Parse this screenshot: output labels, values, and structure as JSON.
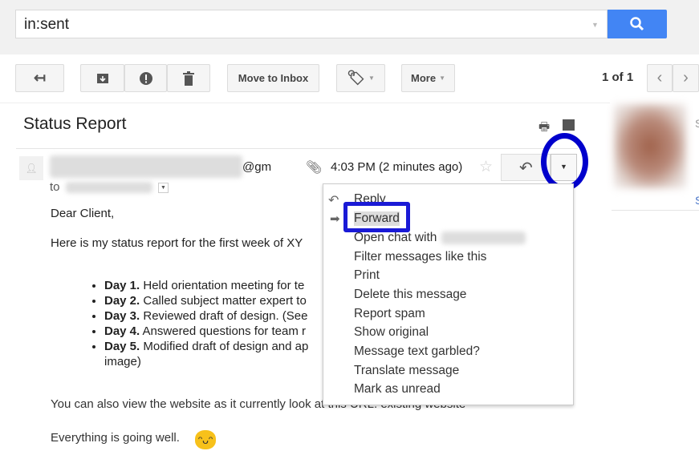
{
  "search": {
    "value": "in:sent"
  },
  "toolbar": {
    "move_to_inbox": "Move to Inbox",
    "more": "More",
    "pagination": "1 of 1"
  },
  "message": {
    "subject": "Status Report",
    "sender_suffix": "@gm",
    "to_label": "to",
    "time": "4:03 PM (2 minutes ago)",
    "greeting": "Dear Client,",
    "intro": "Here is my status report for the first week of XY",
    "days": [
      {
        "day": "Day 1.",
        "text": " Held orientation meeting for te"
      },
      {
        "day": "Day 2.",
        "text": " Called subject matter expert to"
      },
      {
        "day": "Day 3.",
        "text": " Reviewed draft of design. (See"
      },
      {
        "day": "Day 4.",
        "text": " Answered questions for team r"
      },
      {
        "day": "Day 5.",
        "text": " Modified draft of design and ap"
      }
    ],
    "day5_cont": "image)",
    "website_line": "You can also view the website as it currently look at this URL: existing website",
    "closing": "Everything is going well."
  },
  "menu": {
    "items": [
      "Reply",
      "Forward",
      "Open chat with",
      "Filter messages like this",
      "Print",
      "Delete this message",
      "Report spam",
      "Show original",
      "Message text garbled?",
      "Translate message",
      "Mark as unread"
    ]
  },
  "side": {
    "letter1": "S",
    "letter2": "S"
  },
  "colors": {
    "accent": "#4285f4",
    "highlight": "#0000cc"
  }
}
